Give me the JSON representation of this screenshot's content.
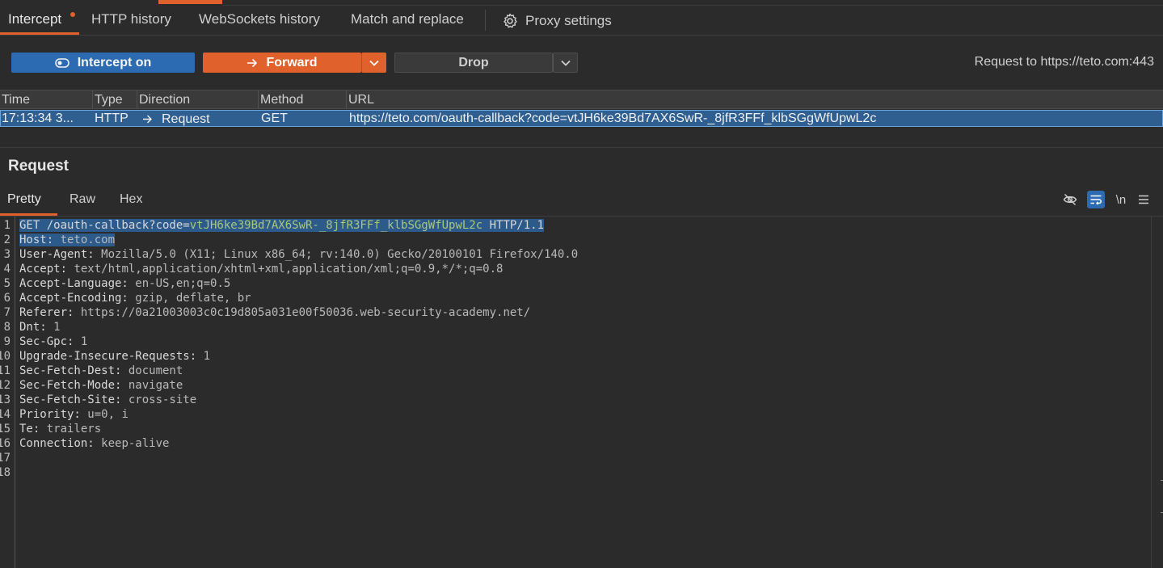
{
  "tabs": [
    {
      "label": "Intercept"
    },
    {
      "label": "HTTP history"
    },
    {
      "label": "WebSockets history"
    },
    {
      "label": "Match and replace"
    },
    {
      "label": "Proxy settings"
    }
  ],
  "controls": {
    "intercept_label": "Intercept on",
    "forward_label": "Forward",
    "drop_label": "Drop",
    "request_to": "Request to https://teto.com:443"
  },
  "table": {
    "headers": [
      "Time",
      "Type",
      "Direction",
      "Method",
      "URL"
    ],
    "row": {
      "time": "17:13:34 3...",
      "type": "HTTP",
      "direction": "Request",
      "method": "GET",
      "url": "https://teto.com/oauth-callback?code=vtJH6ke39Bd7AX6SwR-_8jfR3FFf_klbSGgWfUpwL2c"
    }
  },
  "request": {
    "title": "Request",
    "subtabs": [
      "Pretty",
      "Raw",
      "Hex"
    ],
    "newline_toggle": "\\n",
    "lines": [
      {
        "n": "1",
        "k": "GET /oauth-callback?code=",
        "v": "vtJH6ke39Bd7AX6SwR-_8jfR3FFf_klbSGgWfUpwL2c",
        "t": " HTTP/1.1"
      },
      {
        "n": "2",
        "k": "Host: ",
        "v": "teto.com",
        "t": ""
      },
      {
        "n": "3",
        "k": "User-Agent: ",
        "v": "Mozilla/5.0 (X11; Linux x86_64; rv:140.0) Gecko/20100101 Firefox/140.0",
        "t": ""
      },
      {
        "n": "4",
        "k": "Accept: ",
        "v": "text/html,application/xhtml+xml,application/xml;q=0.9,*/*;q=0.8",
        "t": ""
      },
      {
        "n": "5",
        "k": "Accept-Language: ",
        "v": "en-US,en;q=0.5",
        "t": ""
      },
      {
        "n": "6",
        "k": "Accept-Encoding: ",
        "v": "gzip, deflate, br",
        "t": ""
      },
      {
        "n": "7",
        "k": "Referer: ",
        "v": "https://0a21003003c0c19d805a031e00f50036.web-security-academy.net/",
        "t": ""
      },
      {
        "n": "8",
        "k": "Dnt: ",
        "v": "1",
        "t": ""
      },
      {
        "n": "9",
        "k": "Sec-Gpc: ",
        "v": "1",
        "t": ""
      },
      {
        "n": "10",
        "k": "Upgrade-Insecure-Requests: ",
        "v": "1",
        "t": ""
      },
      {
        "n": "11",
        "k": "Sec-Fetch-Dest: ",
        "v": "document",
        "t": ""
      },
      {
        "n": "12",
        "k": "Sec-Fetch-Mode: ",
        "v": "navigate",
        "t": ""
      },
      {
        "n": "13",
        "k": "Sec-Fetch-Site: ",
        "v": "cross-site",
        "t": ""
      },
      {
        "n": "14",
        "k": "Priority: ",
        "v": "u=0, i",
        "t": ""
      },
      {
        "n": "15",
        "k": "Te: ",
        "v": "trailers",
        "t": ""
      },
      {
        "n": "16",
        "k": "Connection: ",
        "v": "keep-alive",
        "t": ""
      },
      {
        "n": "17",
        "k": "",
        "v": "",
        "t": ""
      },
      {
        "n": "18",
        "k": "",
        "v": "",
        "t": ""
      }
    ]
  },
  "colors": {
    "accent": "#e0612c",
    "intercept_blue": "#2c6bb1",
    "selected_row": "#2f5f91",
    "background": "#2b2b2b"
  },
  "icons": [
    "gear-icon",
    "toggle-icon",
    "arrow-right-icon",
    "chevron-down-icon",
    "eye-off-icon",
    "wrap-icon",
    "menu-icon"
  ]
}
